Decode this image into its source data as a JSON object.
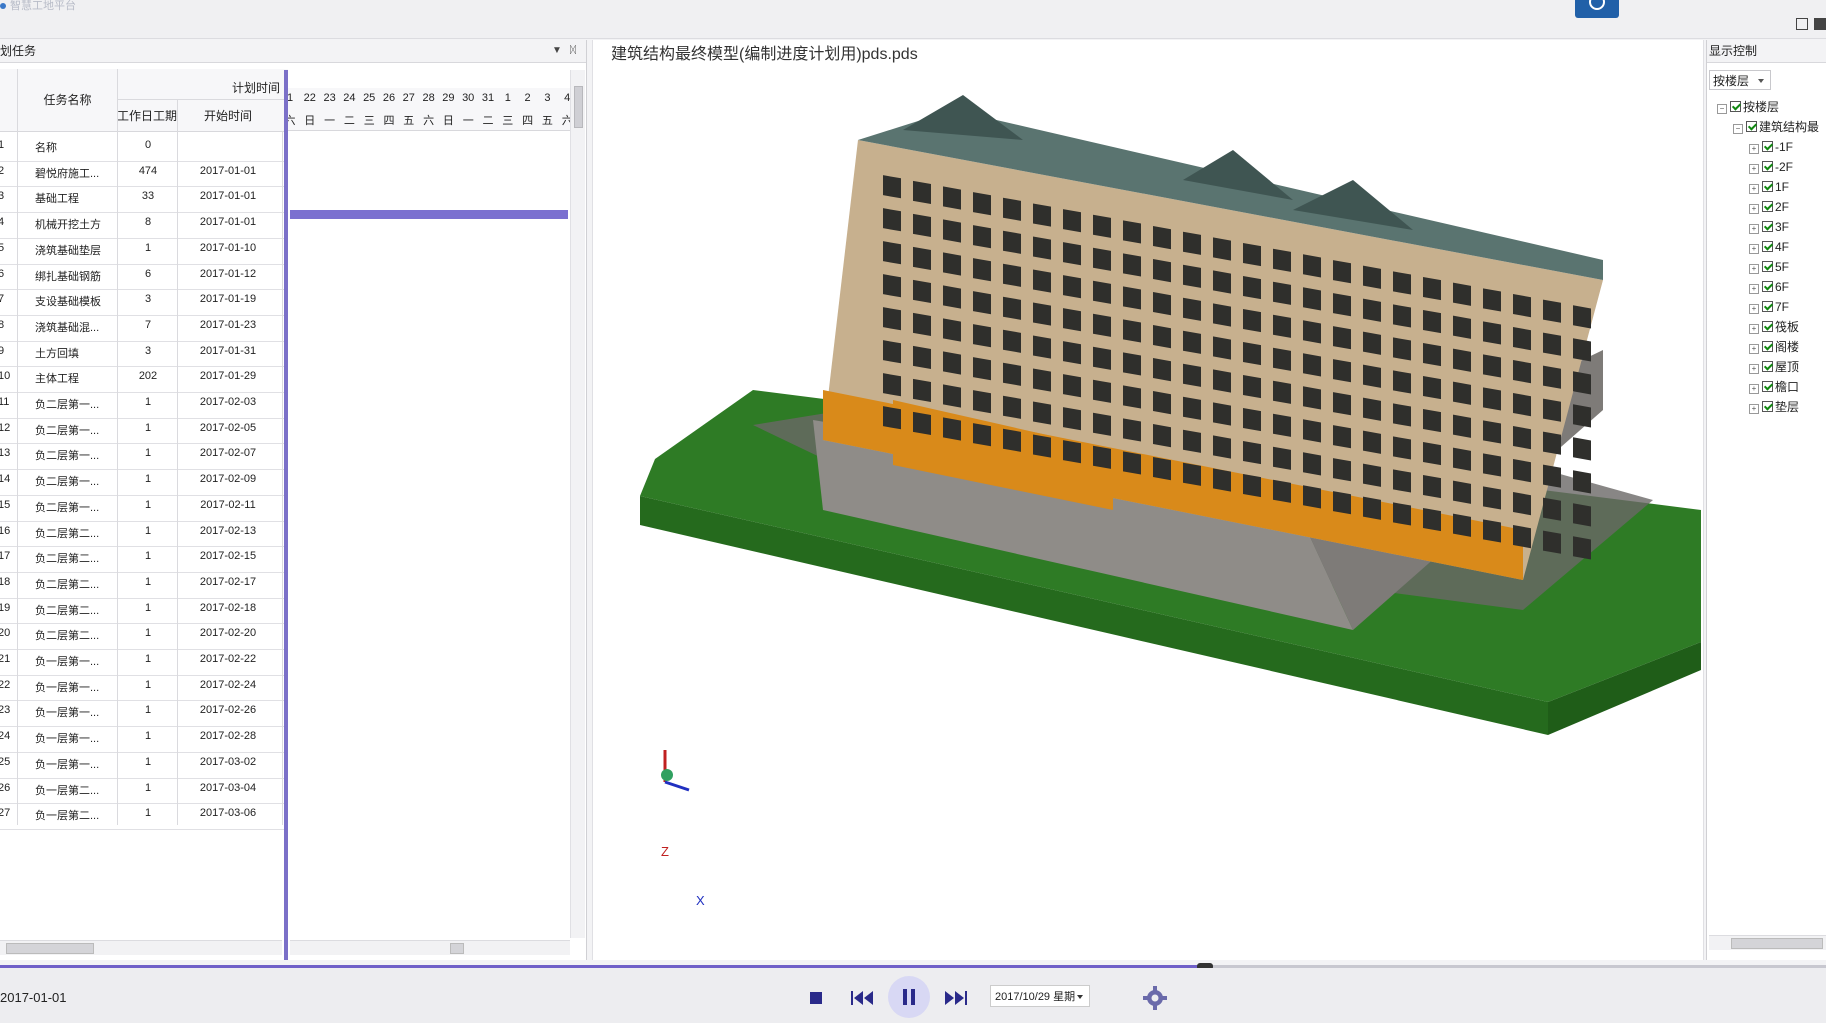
{
  "top": {
    "app_title_faint": "智慧工地平台"
  },
  "left_panel": {
    "title": "划任务",
    "col_plan_time": "计划时间",
    "col_task_name": "任务名称",
    "col_work_days": "工作日工期",
    "col_start_time": "开始时间",
    "gantt_dates": [
      "1",
      "22",
      "23",
      "24",
      "25",
      "26",
      "27",
      "28",
      "29",
      "30",
      "31",
      "1",
      "2",
      "3",
      "4"
    ],
    "gantt_weekdays": [
      "六",
      "日",
      "一",
      "二",
      "三",
      "四",
      "五",
      "六",
      "日",
      "一",
      "二",
      "三",
      "四",
      "五",
      "六"
    ],
    "rows": [
      {
        "idx": "1",
        "name": "名称",
        "days": "0",
        "date": ""
      },
      {
        "idx": "2",
        "name": "碧悦府施工...",
        "days": "474",
        "date": "2017-01-01"
      },
      {
        "idx": "3",
        "name": "基础工程",
        "days": "33",
        "date": "2017-01-01"
      },
      {
        "idx": "4",
        "name": "机械开挖土方",
        "days": "8",
        "date": "2017-01-01"
      },
      {
        "idx": "5",
        "name": "浇筑基础垫层",
        "days": "1",
        "date": "2017-01-10"
      },
      {
        "idx": "6",
        "name": "绑扎基础钢筋",
        "days": "6",
        "date": "2017-01-12"
      },
      {
        "idx": "7",
        "name": "支设基础模板",
        "days": "3",
        "date": "2017-01-19"
      },
      {
        "idx": "8",
        "name": "浇筑基础混...",
        "days": "7",
        "date": "2017-01-23"
      },
      {
        "idx": "9",
        "name": "土方回填",
        "days": "3",
        "date": "2017-01-31"
      },
      {
        "idx": "10",
        "name": "主体工程",
        "days": "202",
        "date": "2017-01-29"
      },
      {
        "idx": "11",
        "name": "负二层第一...",
        "days": "1",
        "date": "2017-02-03"
      },
      {
        "idx": "12",
        "name": "负二层第一...",
        "days": "1",
        "date": "2017-02-05"
      },
      {
        "idx": "13",
        "name": "负二层第一...",
        "days": "1",
        "date": "2017-02-07"
      },
      {
        "idx": "14",
        "name": "负二层第一...",
        "days": "1",
        "date": "2017-02-09"
      },
      {
        "idx": "15",
        "name": "负二层第一...",
        "days": "1",
        "date": "2017-02-11"
      },
      {
        "idx": "16",
        "name": "负二层第二...",
        "days": "1",
        "date": "2017-02-13"
      },
      {
        "idx": "17",
        "name": "负二层第二...",
        "days": "1",
        "date": "2017-02-15"
      },
      {
        "idx": "18",
        "name": "负二层第二...",
        "days": "1",
        "date": "2017-02-17"
      },
      {
        "idx": "19",
        "name": "负二层第二...",
        "days": "1",
        "date": "2017-02-18"
      },
      {
        "idx": "20",
        "name": "负二层第二...",
        "days": "1",
        "date": "2017-02-20"
      },
      {
        "idx": "21",
        "name": "负一层第一...",
        "days": "1",
        "date": "2017-02-22"
      },
      {
        "idx": "22",
        "name": "负一层第一...",
        "days": "1",
        "date": "2017-02-24"
      },
      {
        "idx": "23",
        "name": "负一层第一...",
        "days": "1",
        "date": "2017-02-26"
      },
      {
        "idx": "24",
        "name": "负一层第一...",
        "days": "1",
        "date": "2017-02-28"
      },
      {
        "idx": "25",
        "name": "负一层第一...",
        "days": "1",
        "date": "2017-03-02"
      },
      {
        "idx": "26",
        "name": "负一层第二...",
        "days": "1",
        "date": "2017-03-04"
      },
      {
        "idx": "27",
        "name": "负一层第二...",
        "days": "1",
        "date": "2017-03-06"
      }
    ]
  },
  "viewport": {
    "title": "建筑结构最终模型(编制进度计划用)pds.pds",
    "axis_z": "Z",
    "axis_x": "X",
    "colors": {
      "ground": "#2d7a24",
      "facade": "#c7b08e",
      "orange": "#d98a1a",
      "roof": "#4f6d69",
      "base": "#8f8c88"
    }
  },
  "right_panel": {
    "title": "显示控制",
    "combo_value": "按楼层",
    "tree": [
      {
        "label": "按楼层",
        "level": 0
      },
      {
        "label": "建筑结构最",
        "level": 1
      },
      {
        "label": "-1F",
        "level": 2
      },
      {
        "label": "-2F",
        "level": 2
      },
      {
        "label": "1F",
        "level": 2
      },
      {
        "label": "2F",
        "level": 2
      },
      {
        "label": "3F",
        "level": 2
      },
      {
        "label": "4F",
        "level": 2
      },
      {
        "label": "5F",
        "level": 2
      },
      {
        "label": "6F",
        "level": 2
      },
      {
        "label": "7F",
        "level": 2
      },
      {
        "label": "筏板",
        "level": 2
      },
      {
        "label": "阁楼",
        "level": 2
      },
      {
        "label": "屋顶",
        "level": 2
      },
      {
        "label": "檐口",
        "level": 2
      },
      {
        "label": "垫层",
        "level": 2
      }
    ]
  },
  "bottom": {
    "current_date": "2017-01-01",
    "date_select_value": "2017/10/29 星期",
    "progress": 0.66,
    "icons": [
      "stop-icon",
      "previous-icon",
      "pause-icon",
      "next-icon",
      "gear-icon"
    ]
  }
}
